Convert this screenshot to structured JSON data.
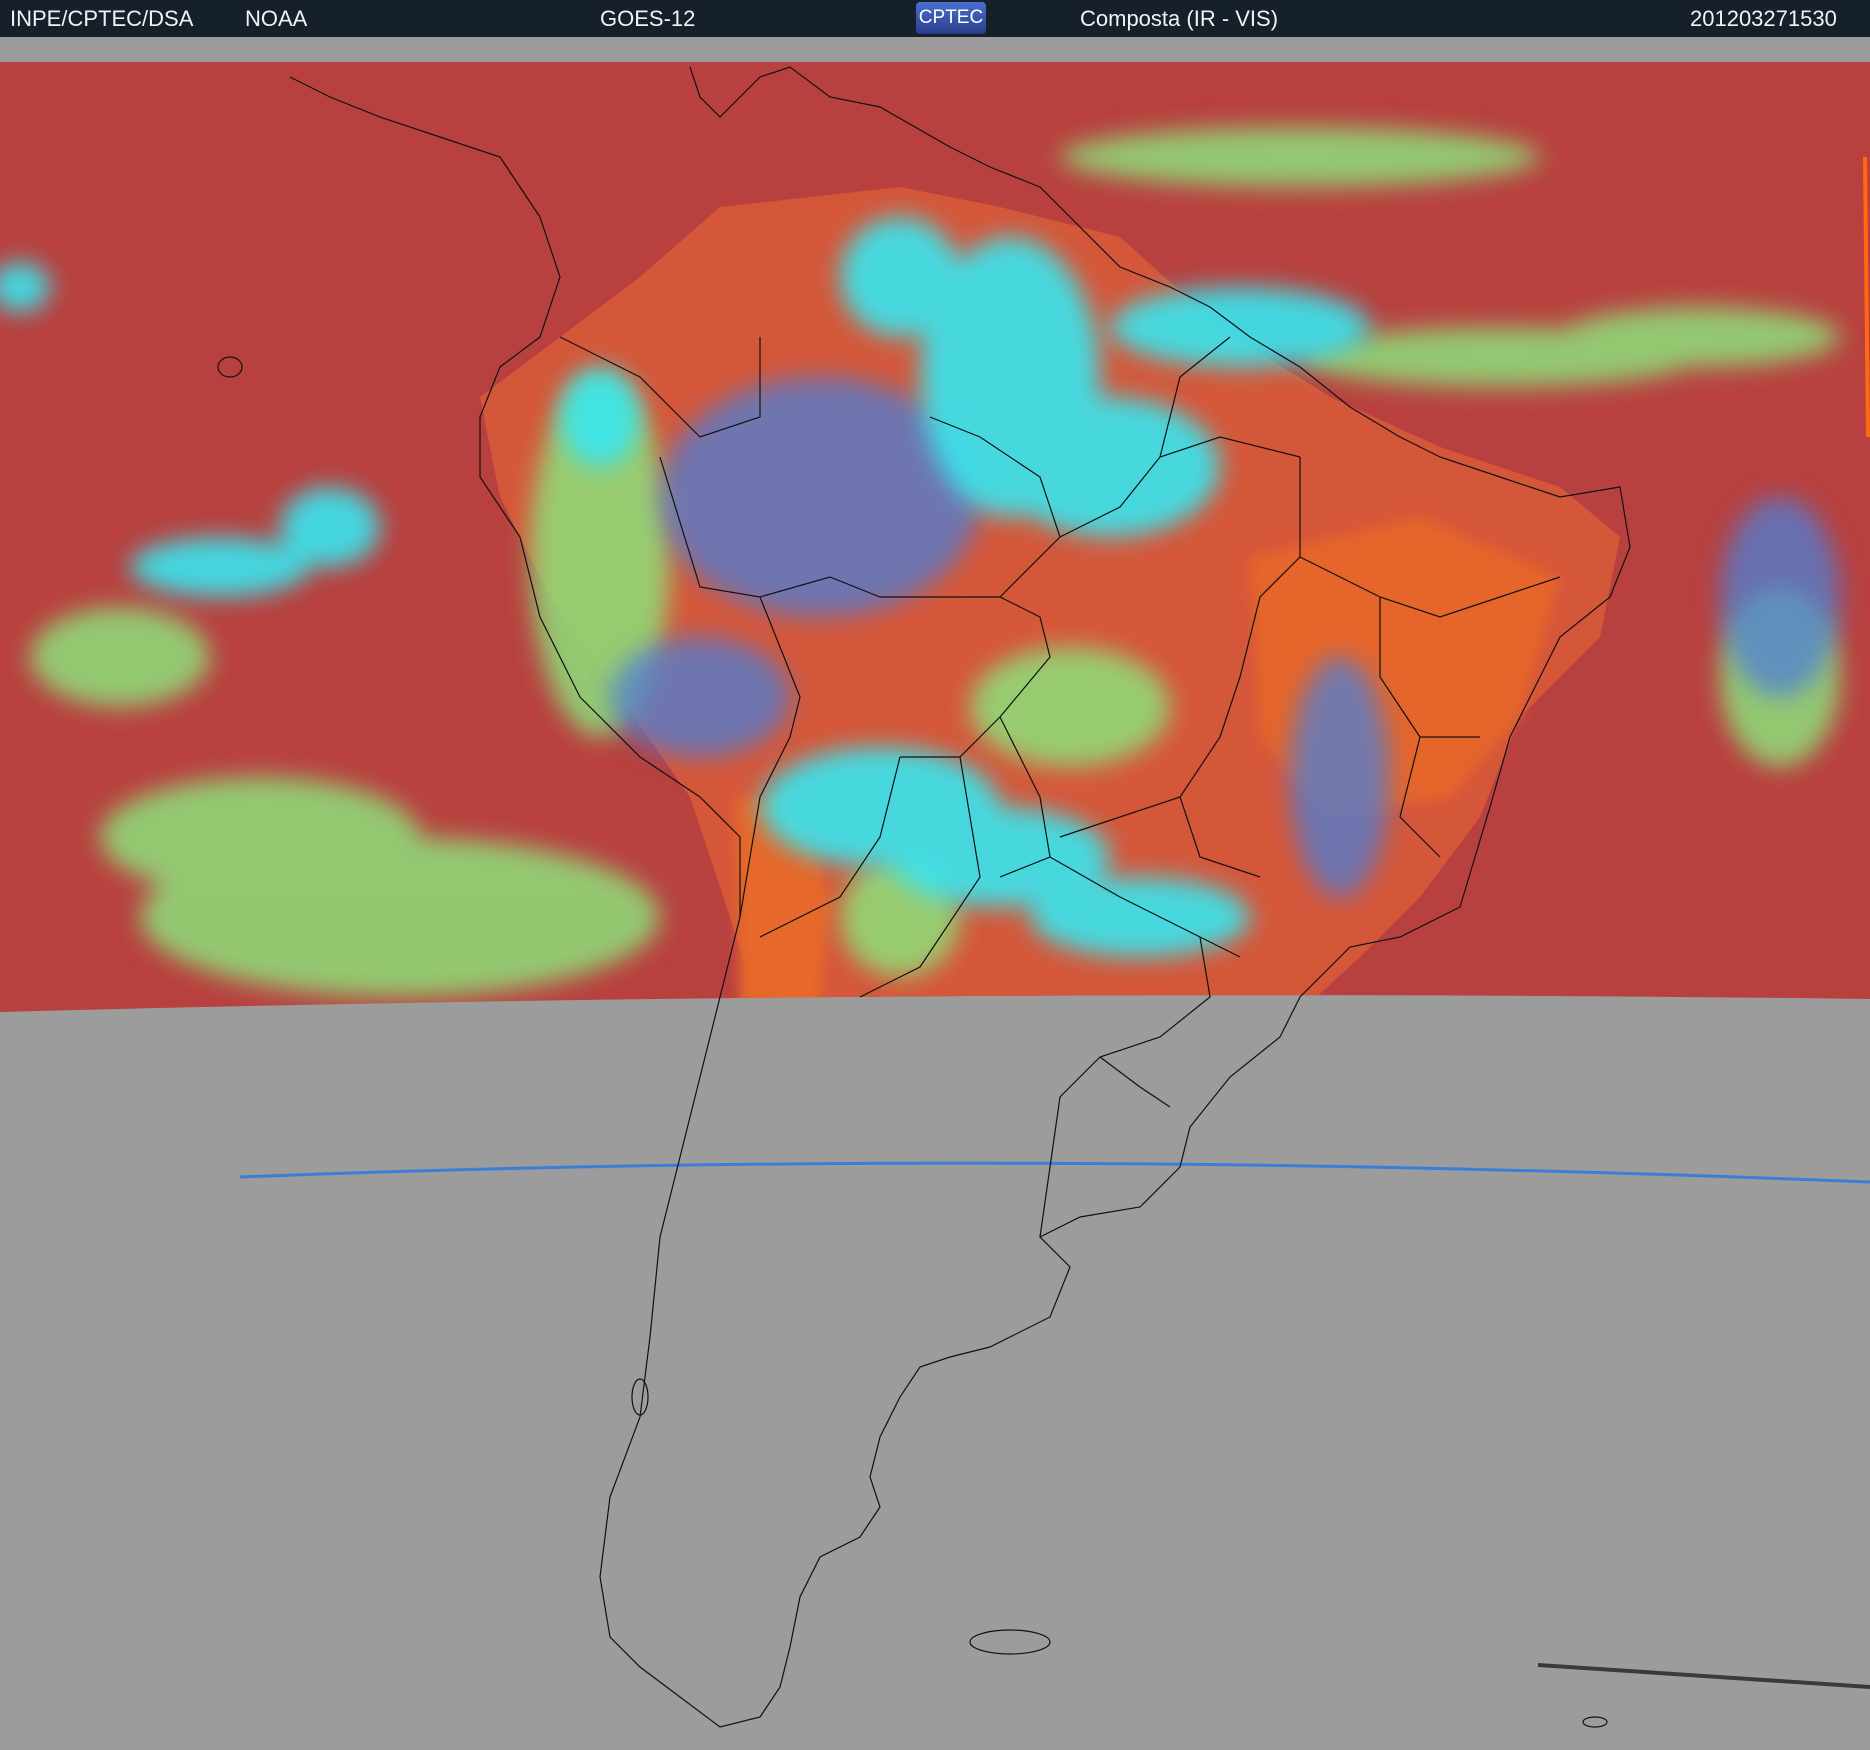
{
  "header": {
    "agency": "INPE/CPTEC/DSA",
    "provider": "NOAA",
    "satellite": "GOES-12",
    "logo_text": "CPTEC",
    "product": "Composta (IR - VIS)",
    "timestamp": "201203271530"
  },
  "colors": {
    "background": "#9c9c9c",
    "bar": "#15202a",
    "ir_warm": "#b8413f",
    "land_warm": "#e0602c",
    "low_cloud": "#8ee07a",
    "high_cloud": "#39e6f0",
    "mid_cloud": "#4d7fd6",
    "coastline": "#111111"
  }
}
